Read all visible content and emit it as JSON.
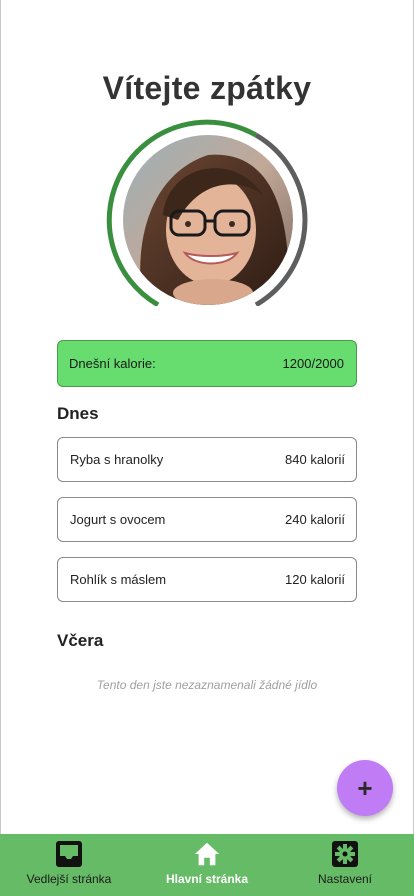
{
  "header": {
    "title": "Vítejte zpátky"
  },
  "progress": {
    "consumed": 1200,
    "goal": 2000,
    "ring_color": "#3a8f3f",
    "track_color": "#5e5e5e"
  },
  "calories_card": {
    "label": "Dnešní kalorie:",
    "value": "1200/2000",
    "color": "#66dd6e"
  },
  "today": {
    "title": "Dnes",
    "items": [
      {
        "name": "Ryba s hranolky",
        "calories": "840 kalorií"
      },
      {
        "name": "Jogurt s ovocem",
        "calories": "240 kalorií"
      },
      {
        "name": "Rohlík s máslem",
        "calories": "120 kalorií"
      }
    ]
  },
  "yesterday": {
    "title": "Včera",
    "empty_message": "Tento den jste nezaznamenali žádné jídlo"
  },
  "fab": {
    "label": "+",
    "color": "#c07cf4"
  },
  "bottom_nav": {
    "color": "#66bb66",
    "items": [
      {
        "label": "Vedlejší stránka",
        "icon": "inbox-icon",
        "active": false
      },
      {
        "label": "Hlavní stránka",
        "icon": "home-icon",
        "active": true
      },
      {
        "label": "Nastavení",
        "icon": "gear-icon",
        "active": false
      }
    ]
  }
}
